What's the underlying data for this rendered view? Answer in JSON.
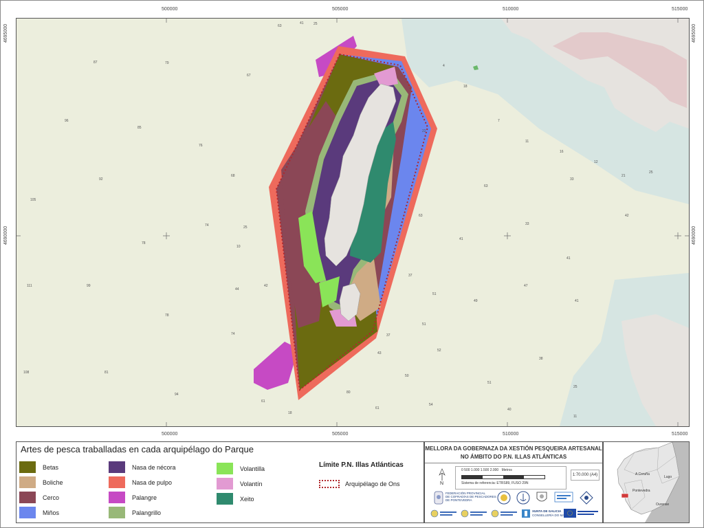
{
  "colors": {
    "betas": "#6b6b10",
    "boliche": "#cfab85",
    "cerco": "#8b4756",
    "minos": "#6b86ee",
    "nasa_necora": "#5a3a7c",
    "nasa_pulpo": "#ee6a5c",
    "palangre": "#c64ac4",
    "palangrillo": "#98b878",
    "volantilla": "#8ae458",
    "volantin": "#e29ad2",
    "xeito": "#2f8a6e",
    "limit": "#b0272b",
    "land": "#e5e3e0",
    "sea": "#d5e4e0"
  },
  "coords": {
    "top": [
      "500000",
      "505000",
      "510000",
      "515000"
    ],
    "bottom": [
      "500000",
      "505000",
      "510000",
      "515000"
    ],
    "left": [
      "4695000",
      "4690000"
    ],
    "right": [
      "4695000",
      "4690000"
    ]
  },
  "legend": {
    "title": "Artes de pesca traballadas en cada arquipélago do Parque",
    "items": [
      {
        "label": "Betas",
        "color": "#6b6b10"
      },
      {
        "label": "Boliche",
        "color": "#cfab85"
      },
      {
        "label": "Cerco",
        "color": "#8b4756"
      },
      {
        "label": "Miños",
        "color": "#6b86ee"
      },
      {
        "label": "Nasa de nécora",
        "color": "#5a3a7c"
      },
      {
        "label": "Nasa de pulpo",
        "color": "#ee6a5c"
      },
      {
        "label": "Palangre",
        "color": "#c64ac4"
      },
      {
        "label": "Palangrillo",
        "color": "#98b878"
      },
      {
        "label": "Volantilla",
        "color": "#8ae458"
      },
      {
        "label": "Volantín",
        "color": "#e29ad2"
      },
      {
        "label": "Xeito",
        "color": "#2f8a6e"
      }
    ],
    "limit_title": "Límite P.N. Illas Atlánticas",
    "limit_item": "Arquipélago de Ons"
  },
  "title_block": {
    "line1": "MELLORA DA GOBERNAZA DA XESTIÓN PESQUEIRA ARTESANAL",
    "line2": "NO ÁMBITO DO P.N. ILLAS ATLÁNTICAS",
    "north": "N",
    "scale_ticks": "0      500    1.000    1.500    2.000",
    "scale_unit": "Metros",
    "scale_ref": "Sistema de referencia: ETRS89, FUSO 29N",
    "scale_num": "1:70.000 (A4)",
    "logo_fed": "FEDERACIÓN PROVINCIAL\nDE COFRADÍAS DE PESCADORES\nDE PONTEVEDRA",
    "logo_xunta": "XUNTA DE GALICIA",
    "logo_xunta_sub": "CONSELLERÍA DO MAR"
  },
  "locator": {
    "labels": [
      "A Coruña",
      "Lugo",
      "Pontevedra",
      "Ourense"
    ]
  }
}
